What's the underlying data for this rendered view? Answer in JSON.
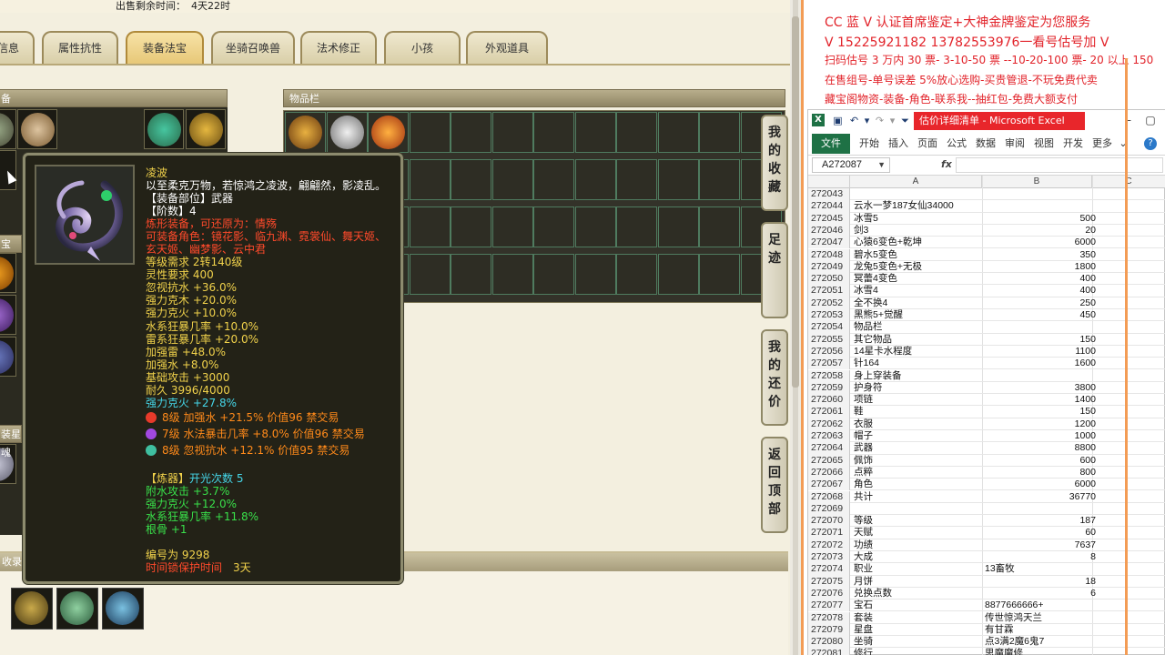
{
  "game": {
    "countdown_label": "出售剩余时间：",
    "countdown_value": "4天22时",
    "tabs": [
      {
        "label": "信息"
      },
      {
        "label": "属性抗性"
      },
      {
        "label": "装备法宝"
      },
      {
        "label": "坐骑召唤兽"
      },
      {
        "label": "法术修正"
      },
      {
        "label": "小孩"
      },
      {
        "label": "外观道具"
      }
    ],
    "active_tab": "装备法宝",
    "left_panel_title": "备",
    "item_panel_title": "物品栏",
    "side_buttons": [
      "我的收藏",
      "足迹",
      "我的还价",
      "返回顶部"
    ],
    "left_labels": [
      "宝",
      "装星魂",
      "收录的"
    ],
    "tooltip": {
      "name": "凌波",
      "desc": "以至柔克万物，若惊鸿之凌波，翩翩然，影凌乱。",
      "slot": "【装备部位】武器",
      "tier": "【阶数】4",
      "refine_note": "炼形装备，可还原为：情殇",
      "usable_roles": "可装备角色：镜花影、临九渊、霓裳仙、舞天姬、",
      "usable_roles_2": "玄天姬、幽梦影、云中君",
      "level_req": "等级需求 2转140级",
      "spirit_req": "灵性要求 400",
      "stats": [
        "忽视抗水 +36.0%",
        "强力克木 +20.0%",
        "强力克火 +10.0%",
        "水系狂暴几率 +10.0%",
        "雷系狂暴几率 +20.0%",
        "加强雷 +48.0%",
        "加强水 +8.0%",
        "基础攻击 +3000",
        "耐久 3996/4000"
      ],
      "special_stat": "强力克火 +27.8%",
      "gems": [
        {
          "text": "8级 加强水 +21.5% 价值96 禁交易",
          "color": "#e83a2a"
        },
        {
          "text": "7级 水法暴击几率 +8.0% 价值96 禁交易",
          "color": "#a248e0"
        },
        {
          "text": "8级 忽视抗水 +12.1% 价值95 禁交易",
          "color": "#3fbfa0"
        }
      ],
      "forge_label": "【炼器】",
      "forge_count": "开光次数 5",
      "forge_stats": [
        "附水攻击 +3.7%",
        "强力克火 +12.0%",
        "水系狂暴几率 +11.8%",
        "根骨 +1"
      ],
      "serial": "编号为 9298",
      "protect_label": "时间锁保护时间",
      "protect_value": "3天"
    }
  },
  "ad": {
    "lines": [
      "CC 蓝 V 认证首席鉴定+大神金牌鉴定为您服务",
      "V 15225921182    13782553976一看号估号加 V",
      "扫码估号 3 万内 30 票- 3-10-50 票  --10-20-100 票- 20 以上 150",
      "在售组号-单号误差 5%放心选购-买贵管退-不玩免费代卖",
      "藏宝阁物资-装备-角色-联系我--抽红包-免费大额支付"
    ]
  },
  "excel": {
    "title": "估价详细清单 - Microsoft Excel",
    "ribbon_tabs": [
      "文件",
      "开始",
      "插入",
      "页面",
      "公式",
      "数据",
      "审阅",
      "视图",
      "开发",
      "更多"
    ],
    "name_box": "A272087",
    "fx": "fx",
    "columns": [
      "A",
      "B",
      "C"
    ],
    "rows": [
      {
        "n": "272043",
        "a": "",
        "b": ""
      },
      {
        "n": "272044",
        "a": "云水一梦187女仙34000",
        "b": ""
      },
      {
        "n": "272045",
        "a": "冰雪5",
        "b": "500"
      },
      {
        "n": "272046",
        "a": "剑3",
        "b": "20"
      },
      {
        "n": "272047",
        "a": "心猿6变色+乾坤",
        "b": "6000"
      },
      {
        "n": "272048",
        "a": "碧水5变色",
        "b": "350"
      },
      {
        "n": "272049",
        "a": "龙兔5变色+无极",
        "b": "1800"
      },
      {
        "n": "272050",
        "a": "冥蕾4变色",
        "b": "400"
      },
      {
        "n": "272051",
        "a": "冰雪4",
        "b": "400"
      },
      {
        "n": "272052",
        "a": "全不换4",
        "b": "250"
      },
      {
        "n": "272053",
        "a": "黑熊5+觉醒",
        "b": "450"
      },
      {
        "n": "272054",
        "a": "物品栏",
        "b": ""
      },
      {
        "n": "272055",
        "a": "其它物品",
        "b": "150"
      },
      {
        "n": "272056",
        "a": "14星卡水程度",
        "b": "1100"
      },
      {
        "n": "272057",
        "a": "针164",
        "b": "1600"
      },
      {
        "n": "272058",
        "a": "身上穿装备",
        "b": ""
      },
      {
        "n": "272059",
        "a": "护身符",
        "b": "3800"
      },
      {
        "n": "272060",
        "a": "项链",
        "b": "1400"
      },
      {
        "n": "272061",
        "a": "鞋",
        "b": "150"
      },
      {
        "n": "272062",
        "a": "衣服",
        "b": "1200"
      },
      {
        "n": "272063",
        "a": "帽子",
        "b": "1000"
      },
      {
        "n": "272064",
        "a": "武器",
        "b": "8800"
      },
      {
        "n": "272065",
        "a": "佩饰",
        "b": "600"
      },
      {
        "n": "272066",
        "a": "点粹",
        "b": "800"
      },
      {
        "n": "272067",
        "a": "角色",
        "b": "6000"
      },
      {
        "n": "272068",
        "a": "共计",
        "b": "36770"
      },
      {
        "n": "272069",
        "a": "",
        "b": ""
      },
      {
        "n": "272070",
        "a": "等级",
        "b": "187"
      },
      {
        "n": "272071",
        "a": "天赋",
        "b": "60"
      },
      {
        "n": "272072",
        "a": "功绩",
        "b": "7637"
      },
      {
        "n": "272073",
        "a": "大成",
        "b": "8"
      },
      {
        "n": "272074",
        "a": "职业",
        "b": "13畜牧",
        "left": true
      },
      {
        "n": "272075",
        "a": "月饼",
        "b": "18"
      },
      {
        "n": "272076",
        "a": "兑换点数",
        "b": "6"
      },
      {
        "n": "272077",
        "a": "宝石",
        "b": "8877666666+",
        "left": true
      },
      {
        "n": "272078",
        "a": "套装",
        "b": "传世惊鸿天兰",
        "left": true
      },
      {
        "n": "272079",
        "a": "星盘",
        "b": "有甘霖",
        "left": true
      },
      {
        "n": "272080",
        "a": "坐骑",
        "b": "点3满2魔6鬼7",
        "left": true
      },
      {
        "n": "272081",
        "a": "修行",
        "b": "思魔魔修",
        "left": true
      }
    ]
  }
}
